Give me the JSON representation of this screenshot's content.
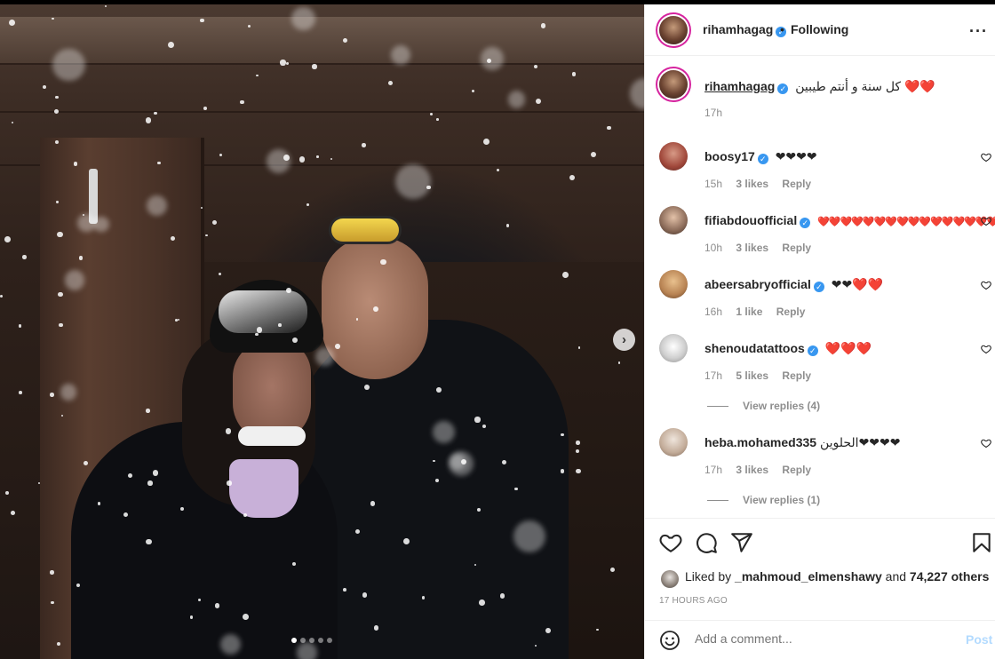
{
  "post": {
    "author": "rihamhagag",
    "follow_status": "Following",
    "bullet": "•",
    "more_icon": "more-horizontal-icon",
    "caption": "كل سنة و أنتم طيبين ❤️❤️",
    "caption_time": "17h",
    "carousel": {
      "total": 5,
      "active": 0,
      "next_icon": "chevron-right-icon"
    }
  },
  "comments": [
    {
      "user": "boosy17",
      "verified": true,
      "text": "❤❤❤❤",
      "time": "15h",
      "likes": "3 likes",
      "reply": "Reply"
    },
    {
      "user": "fifiabdouofficial",
      "verified": true,
      "text": "❤️❤️❤️❤️❤️❤️❤️❤️❤️❤️❤️❤️❤️❤️❤️❤️❤️",
      "time": "10h",
      "likes": "3 likes",
      "reply": "Reply"
    },
    {
      "user": "abeersabryofficial",
      "verified": true,
      "text": "❤❤❤️❤️",
      "time": "16h",
      "likes": "1 like",
      "reply": "Reply"
    },
    {
      "user": "shenoudatattoos",
      "verified": true,
      "text": "❤️❤️❤️",
      "time": "17h",
      "likes": "5 likes",
      "reply": "Reply",
      "view_replies": "View replies (4)"
    },
    {
      "user": "heba.mohamed335",
      "verified": false,
      "text": "الحلوين❤❤❤❤",
      "time": "17h",
      "likes": "3 likes",
      "reply": "Reply",
      "view_replies": "View replies (1)"
    }
  ],
  "actions": {
    "icons": [
      "heart-icon",
      "comment-icon",
      "share-icon",
      "bookmark-icon"
    ],
    "liked_by_prefix": "Liked by",
    "liked_by_user": "_mahmoud_elmenshawy",
    "liked_by_and": "and",
    "liked_by_others": "74,227 others",
    "timestamp": "17 HOURS AGO"
  },
  "comment_bar": {
    "emoji_icon": "smiley-icon",
    "placeholder": "Add a comment...",
    "post_label": "Post"
  },
  "colors": {
    "verified": "#3897f0",
    "post_disabled": "#b3dbff",
    "story_ring": "#d6249f"
  }
}
